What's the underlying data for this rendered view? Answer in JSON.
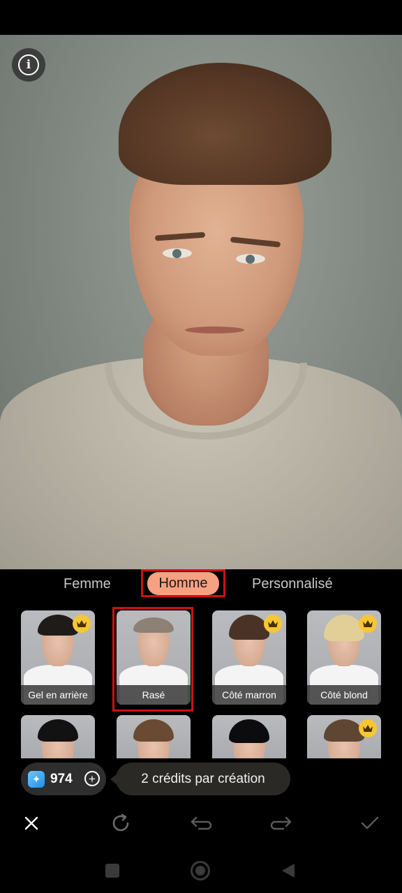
{
  "photo": {
    "info_icon": "info-icon",
    "info_glyph": "i"
  },
  "tabs": [
    {
      "label": "Femme",
      "active": false
    },
    {
      "label": "Homme",
      "active": true
    },
    {
      "label": "Personnalisé",
      "active": false
    }
  ],
  "styles": [
    {
      "label": "Gel en arrière",
      "premium": true,
      "selected": false,
      "hair_color": "#1f1b19"
    },
    {
      "label": "Rasé",
      "premium": false,
      "selected": true,
      "hair_color": "#8d8074"
    },
    {
      "label": "Côté marron",
      "premium": true,
      "selected": false,
      "hair_color": "#4a3326"
    },
    {
      "label": "Côté blond",
      "premium": true,
      "selected": false,
      "hair_color": "#e2cf97"
    },
    {
      "label": "",
      "premium": false,
      "selected": false,
      "hair_color": "#121212"
    },
    {
      "label": "",
      "premium": false,
      "selected": false,
      "hair_color": "#6a4a33"
    },
    {
      "label": "",
      "premium": false,
      "selected": false,
      "hair_color": "#0c0c0f"
    },
    {
      "label": "",
      "premium": true,
      "selected": false,
      "hair_color": "#5e4632"
    }
  ],
  "credits": {
    "count": "974",
    "gem_icon": "gem-icon",
    "add_icon": "plus-circle-icon"
  },
  "tooltip": {
    "text": "2 crédits par création"
  },
  "toolbar": {
    "close_icon": "close-icon",
    "reset_icon": "refresh-icon",
    "undo_icon": "undo-icon",
    "redo_icon": "redo-icon",
    "confirm_icon": "check-icon"
  },
  "colors": {
    "accent_active_tab": "#f6a182",
    "selection_outline": "#d01010",
    "premium_badge": "#f7c634",
    "background": "#000000"
  }
}
